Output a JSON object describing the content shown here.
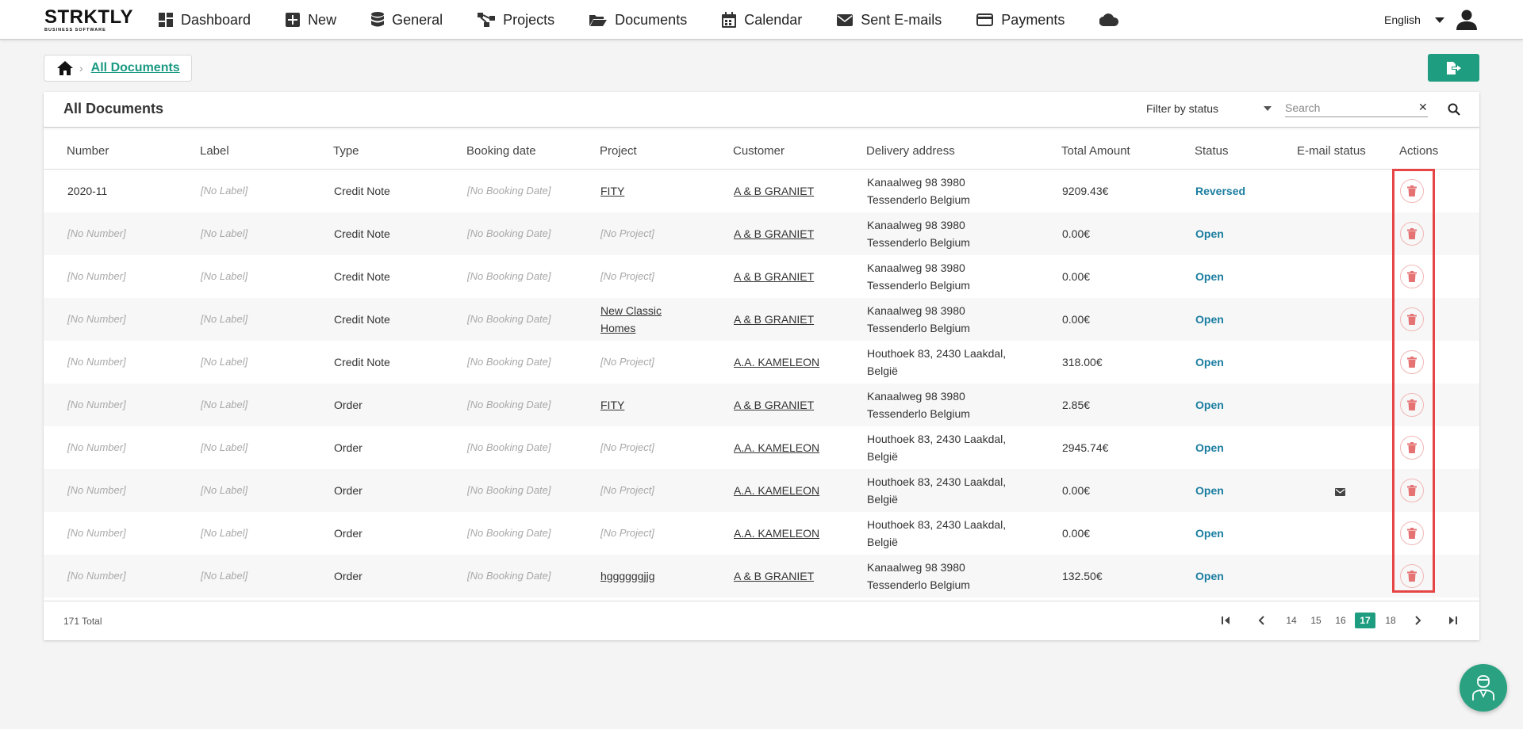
{
  "logo": {
    "brand": "STRKTLY",
    "tagline": "BUSINESS SOFTWARE"
  },
  "nav": {
    "items": [
      {
        "label": "Dashboard",
        "icon": "dashboard-icon"
      },
      {
        "label": "New",
        "icon": "plus-square-icon"
      },
      {
        "label": "General",
        "icon": "database-icon"
      },
      {
        "label": "Projects",
        "icon": "sitemap-icon"
      },
      {
        "label": "Documents",
        "icon": "folder-open-icon"
      },
      {
        "label": "Calendar",
        "icon": "calendar-icon"
      },
      {
        "label": "Sent E-mails",
        "icon": "envelope-icon"
      },
      {
        "label": "Payments",
        "icon": "credit-card-icon"
      }
    ],
    "language": "English"
  },
  "breadcrumb": {
    "current": "All Documents"
  },
  "card": {
    "title": "All Documents",
    "filter_label": "Filter by status",
    "search_placeholder": "Search",
    "search_clear": "✕"
  },
  "table": {
    "headers": [
      "Number",
      "Label",
      "Type",
      "Booking date",
      "Project",
      "Customer",
      "Delivery address",
      "Total Amount",
      "Status",
      "E-mail status",
      "Actions"
    ],
    "rows": [
      {
        "number": "2020-11",
        "label": "[No Label]",
        "type": "Credit Note",
        "booking": "[No Booking Date]",
        "project1": "FITY",
        "project2": "",
        "customer": "A & B GRANIET",
        "addr1": "Kanaalweg 98 3980",
        "addr2": "Tessenderlo Belgium",
        "amount": "9209.43€",
        "status": "Reversed",
        "email": ""
      },
      {
        "number": "[No Number]",
        "label": "[No Label]",
        "type": "Credit Note",
        "booking": "[No Booking Date]",
        "project1": "[No Project]",
        "project2": "",
        "customer": "A & B GRANIET",
        "addr1": "Kanaalweg 98 3980",
        "addr2": "Tessenderlo Belgium",
        "amount": "0.00€",
        "status": "Open",
        "email": ""
      },
      {
        "number": "[No Number]",
        "label": "[No Label]",
        "type": "Credit Note",
        "booking": "[No Booking Date]",
        "project1": "[No Project]",
        "project2": "",
        "customer": "A & B GRANIET",
        "addr1": "Kanaalweg 98 3980",
        "addr2": "Tessenderlo Belgium",
        "amount": "0.00€",
        "status": "Open",
        "email": ""
      },
      {
        "number": "[No Number]",
        "label": "[No Label]",
        "type": "Credit Note",
        "booking": "[No Booking Date]",
        "project1": "New Classic",
        "project2": "Homes",
        "customer": "A & B GRANIET",
        "addr1": "Kanaalweg 98 3980",
        "addr2": "Tessenderlo Belgium",
        "amount": "0.00€",
        "status": "Open",
        "email": ""
      },
      {
        "number": "[No Number]",
        "label": "[No Label]",
        "type": "Credit Note",
        "booking": "[No Booking Date]",
        "project1": "[No Project]",
        "project2": "",
        "customer": "A.A. KAMELEON",
        "addr1": "Houthoek 83, 2430 Laakdal,",
        "addr2": "België",
        "amount": "318.00€",
        "status": "Open",
        "email": ""
      },
      {
        "number": "[No Number]",
        "label": "[No Label]",
        "type": "Order",
        "booking": "[No Booking Date]",
        "project1": "FITY",
        "project2": "",
        "customer": "A & B GRANIET",
        "addr1": "Kanaalweg 98 3980",
        "addr2": "Tessenderlo Belgium",
        "amount": "2.85€",
        "status": "Open",
        "email": ""
      },
      {
        "number": "[No Number]",
        "label": "[No Label]",
        "type": "Order",
        "booking": "[No Booking Date]",
        "project1": "[No Project]",
        "project2": "",
        "customer": "A.A. KAMELEON",
        "addr1": "Houthoek 83, 2430 Laakdal,",
        "addr2": "België",
        "amount": "2945.74€",
        "status": "Open",
        "email": ""
      },
      {
        "number": "[No Number]",
        "label": "[No Label]",
        "type": "Order",
        "booking": "[No Booking Date]",
        "project1": "[No Project]",
        "project2": "",
        "customer": "A.A. KAMELEON",
        "addr1": "Houthoek 83, 2430 Laakdal,",
        "addr2": "België",
        "amount": "0.00€",
        "status": "Open",
        "email": "envelope-icon"
      },
      {
        "number": "[No Number]",
        "label": "[No Label]",
        "type": "Order",
        "booking": "[No Booking Date]",
        "project1": "[No Project]",
        "project2": "",
        "customer": "A.A. KAMELEON",
        "addr1": "Houthoek 83, 2430 Laakdal,",
        "addr2": "België",
        "amount": "0.00€",
        "status": "Open",
        "email": ""
      },
      {
        "number": "[No Number]",
        "label": "[No Label]",
        "type": "Order",
        "booking": "[No Booking Date]",
        "project1": "hggggggjjg",
        "project2": "",
        "customer": "A & B GRANIET",
        "addr1": "Kanaalweg 98 3980",
        "addr2": "Tessenderlo Belgium",
        "amount": "132.50€",
        "status": "Open",
        "email": ""
      }
    ]
  },
  "footer": {
    "total": "171 Total",
    "pages": [
      "14",
      "15",
      "16",
      "17",
      "18"
    ],
    "current_page": "17"
  },
  "colors": {
    "accent": "#1f9d80",
    "status_link": "#1a7da0",
    "highlight": "#e64545",
    "delete": "#e57373"
  }
}
